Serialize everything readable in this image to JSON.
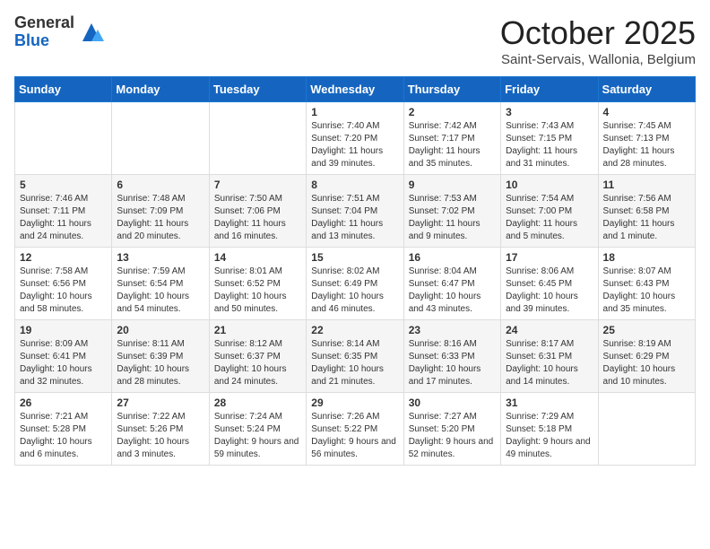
{
  "logo": {
    "general": "General",
    "blue": "Blue"
  },
  "header": {
    "month": "October 2025",
    "subtitle": "Saint-Servais, Wallonia, Belgium"
  },
  "weekdays": [
    "Sunday",
    "Monday",
    "Tuesday",
    "Wednesday",
    "Thursday",
    "Friday",
    "Saturday"
  ],
  "weeks": [
    [
      {
        "day": "",
        "sunrise": "",
        "sunset": "",
        "daylight": ""
      },
      {
        "day": "",
        "sunrise": "",
        "sunset": "",
        "daylight": ""
      },
      {
        "day": "",
        "sunrise": "",
        "sunset": "",
        "daylight": ""
      },
      {
        "day": "1",
        "sunrise": "Sunrise: 7:40 AM",
        "sunset": "Sunset: 7:20 PM",
        "daylight": "Daylight: 11 hours and 39 minutes."
      },
      {
        "day": "2",
        "sunrise": "Sunrise: 7:42 AM",
        "sunset": "Sunset: 7:17 PM",
        "daylight": "Daylight: 11 hours and 35 minutes."
      },
      {
        "day": "3",
        "sunrise": "Sunrise: 7:43 AM",
        "sunset": "Sunset: 7:15 PM",
        "daylight": "Daylight: 11 hours and 31 minutes."
      },
      {
        "day": "4",
        "sunrise": "Sunrise: 7:45 AM",
        "sunset": "Sunset: 7:13 PM",
        "daylight": "Daylight: 11 hours and 28 minutes."
      }
    ],
    [
      {
        "day": "5",
        "sunrise": "Sunrise: 7:46 AM",
        "sunset": "Sunset: 7:11 PM",
        "daylight": "Daylight: 11 hours and 24 minutes."
      },
      {
        "day": "6",
        "sunrise": "Sunrise: 7:48 AM",
        "sunset": "Sunset: 7:09 PM",
        "daylight": "Daylight: 11 hours and 20 minutes."
      },
      {
        "day": "7",
        "sunrise": "Sunrise: 7:50 AM",
        "sunset": "Sunset: 7:06 PM",
        "daylight": "Daylight: 11 hours and 16 minutes."
      },
      {
        "day": "8",
        "sunrise": "Sunrise: 7:51 AM",
        "sunset": "Sunset: 7:04 PM",
        "daylight": "Daylight: 11 hours and 13 minutes."
      },
      {
        "day": "9",
        "sunrise": "Sunrise: 7:53 AM",
        "sunset": "Sunset: 7:02 PM",
        "daylight": "Daylight: 11 hours and 9 minutes."
      },
      {
        "day": "10",
        "sunrise": "Sunrise: 7:54 AM",
        "sunset": "Sunset: 7:00 PM",
        "daylight": "Daylight: 11 hours and 5 minutes."
      },
      {
        "day": "11",
        "sunrise": "Sunrise: 7:56 AM",
        "sunset": "Sunset: 6:58 PM",
        "daylight": "Daylight: 11 hours and 1 minute."
      }
    ],
    [
      {
        "day": "12",
        "sunrise": "Sunrise: 7:58 AM",
        "sunset": "Sunset: 6:56 PM",
        "daylight": "Daylight: 10 hours and 58 minutes."
      },
      {
        "day": "13",
        "sunrise": "Sunrise: 7:59 AM",
        "sunset": "Sunset: 6:54 PM",
        "daylight": "Daylight: 10 hours and 54 minutes."
      },
      {
        "day": "14",
        "sunrise": "Sunrise: 8:01 AM",
        "sunset": "Sunset: 6:52 PM",
        "daylight": "Daylight: 10 hours and 50 minutes."
      },
      {
        "day": "15",
        "sunrise": "Sunrise: 8:02 AM",
        "sunset": "Sunset: 6:49 PM",
        "daylight": "Daylight: 10 hours and 46 minutes."
      },
      {
        "day": "16",
        "sunrise": "Sunrise: 8:04 AM",
        "sunset": "Sunset: 6:47 PM",
        "daylight": "Daylight: 10 hours and 43 minutes."
      },
      {
        "day": "17",
        "sunrise": "Sunrise: 8:06 AM",
        "sunset": "Sunset: 6:45 PM",
        "daylight": "Daylight: 10 hours and 39 minutes."
      },
      {
        "day": "18",
        "sunrise": "Sunrise: 8:07 AM",
        "sunset": "Sunset: 6:43 PM",
        "daylight": "Daylight: 10 hours and 35 minutes."
      }
    ],
    [
      {
        "day": "19",
        "sunrise": "Sunrise: 8:09 AM",
        "sunset": "Sunset: 6:41 PM",
        "daylight": "Daylight: 10 hours and 32 minutes."
      },
      {
        "day": "20",
        "sunrise": "Sunrise: 8:11 AM",
        "sunset": "Sunset: 6:39 PM",
        "daylight": "Daylight: 10 hours and 28 minutes."
      },
      {
        "day": "21",
        "sunrise": "Sunrise: 8:12 AM",
        "sunset": "Sunset: 6:37 PM",
        "daylight": "Daylight: 10 hours and 24 minutes."
      },
      {
        "day": "22",
        "sunrise": "Sunrise: 8:14 AM",
        "sunset": "Sunset: 6:35 PM",
        "daylight": "Daylight: 10 hours and 21 minutes."
      },
      {
        "day": "23",
        "sunrise": "Sunrise: 8:16 AM",
        "sunset": "Sunset: 6:33 PM",
        "daylight": "Daylight: 10 hours and 17 minutes."
      },
      {
        "day": "24",
        "sunrise": "Sunrise: 8:17 AM",
        "sunset": "Sunset: 6:31 PM",
        "daylight": "Daylight: 10 hours and 14 minutes."
      },
      {
        "day": "25",
        "sunrise": "Sunrise: 8:19 AM",
        "sunset": "Sunset: 6:29 PM",
        "daylight": "Daylight: 10 hours and 10 minutes."
      }
    ],
    [
      {
        "day": "26",
        "sunrise": "Sunrise: 7:21 AM",
        "sunset": "Sunset: 5:28 PM",
        "daylight": "Daylight: 10 hours and 6 minutes."
      },
      {
        "day": "27",
        "sunrise": "Sunrise: 7:22 AM",
        "sunset": "Sunset: 5:26 PM",
        "daylight": "Daylight: 10 hours and 3 minutes."
      },
      {
        "day": "28",
        "sunrise": "Sunrise: 7:24 AM",
        "sunset": "Sunset: 5:24 PM",
        "daylight": "Daylight: 9 hours and 59 minutes."
      },
      {
        "day": "29",
        "sunrise": "Sunrise: 7:26 AM",
        "sunset": "Sunset: 5:22 PM",
        "daylight": "Daylight: 9 hours and 56 minutes."
      },
      {
        "day": "30",
        "sunrise": "Sunrise: 7:27 AM",
        "sunset": "Sunset: 5:20 PM",
        "daylight": "Daylight: 9 hours and 52 minutes."
      },
      {
        "day": "31",
        "sunrise": "Sunrise: 7:29 AM",
        "sunset": "Sunset: 5:18 PM",
        "daylight": "Daylight: 9 hours and 49 minutes."
      },
      {
        "day": "",
        "sunrise": "",
        "sunset": "",
        "daylight": ""
      }
    ]
  ]
}
